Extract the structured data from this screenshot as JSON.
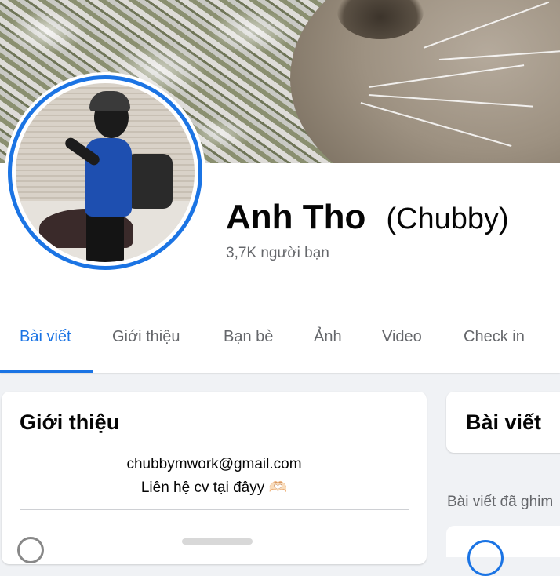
{
  "profile": {
    "name": "Anh Tho",
    "alternate_name": "(Chubby)",
    "friends_count": "3,7K người bạn"
  },
  "tabs": [
    {
      "label": "Bài viết",
      "active": true
    },
    {
      "label": "Giới thiệu",
      "active": false
    },
    {
      "label": "Bạn bè",
      "active": false
    },
    {
      "label": "Ảnh",
      "active": false
    },
    {
      "label": "Video",
      "active": false
    },
    {
      "label": "Check in",
      "active": false
    }
  ],
  "intro": {
    "title": "Giới thiệu",
    "bio_line1": "chubbymwork@gmail.com",
    "bio_line2": "Liên hệ cv tại đâyy 🫶🏻"
  },
  "posts": {
    "title": "Bài viết",
    "pinned_label": "Bài viết đã ghim"
  },
  "colors": {
    "accent": "#1b74e4",
    "muted_text": "#65676b",
    "background": "#f0f2f5"
  }
}
